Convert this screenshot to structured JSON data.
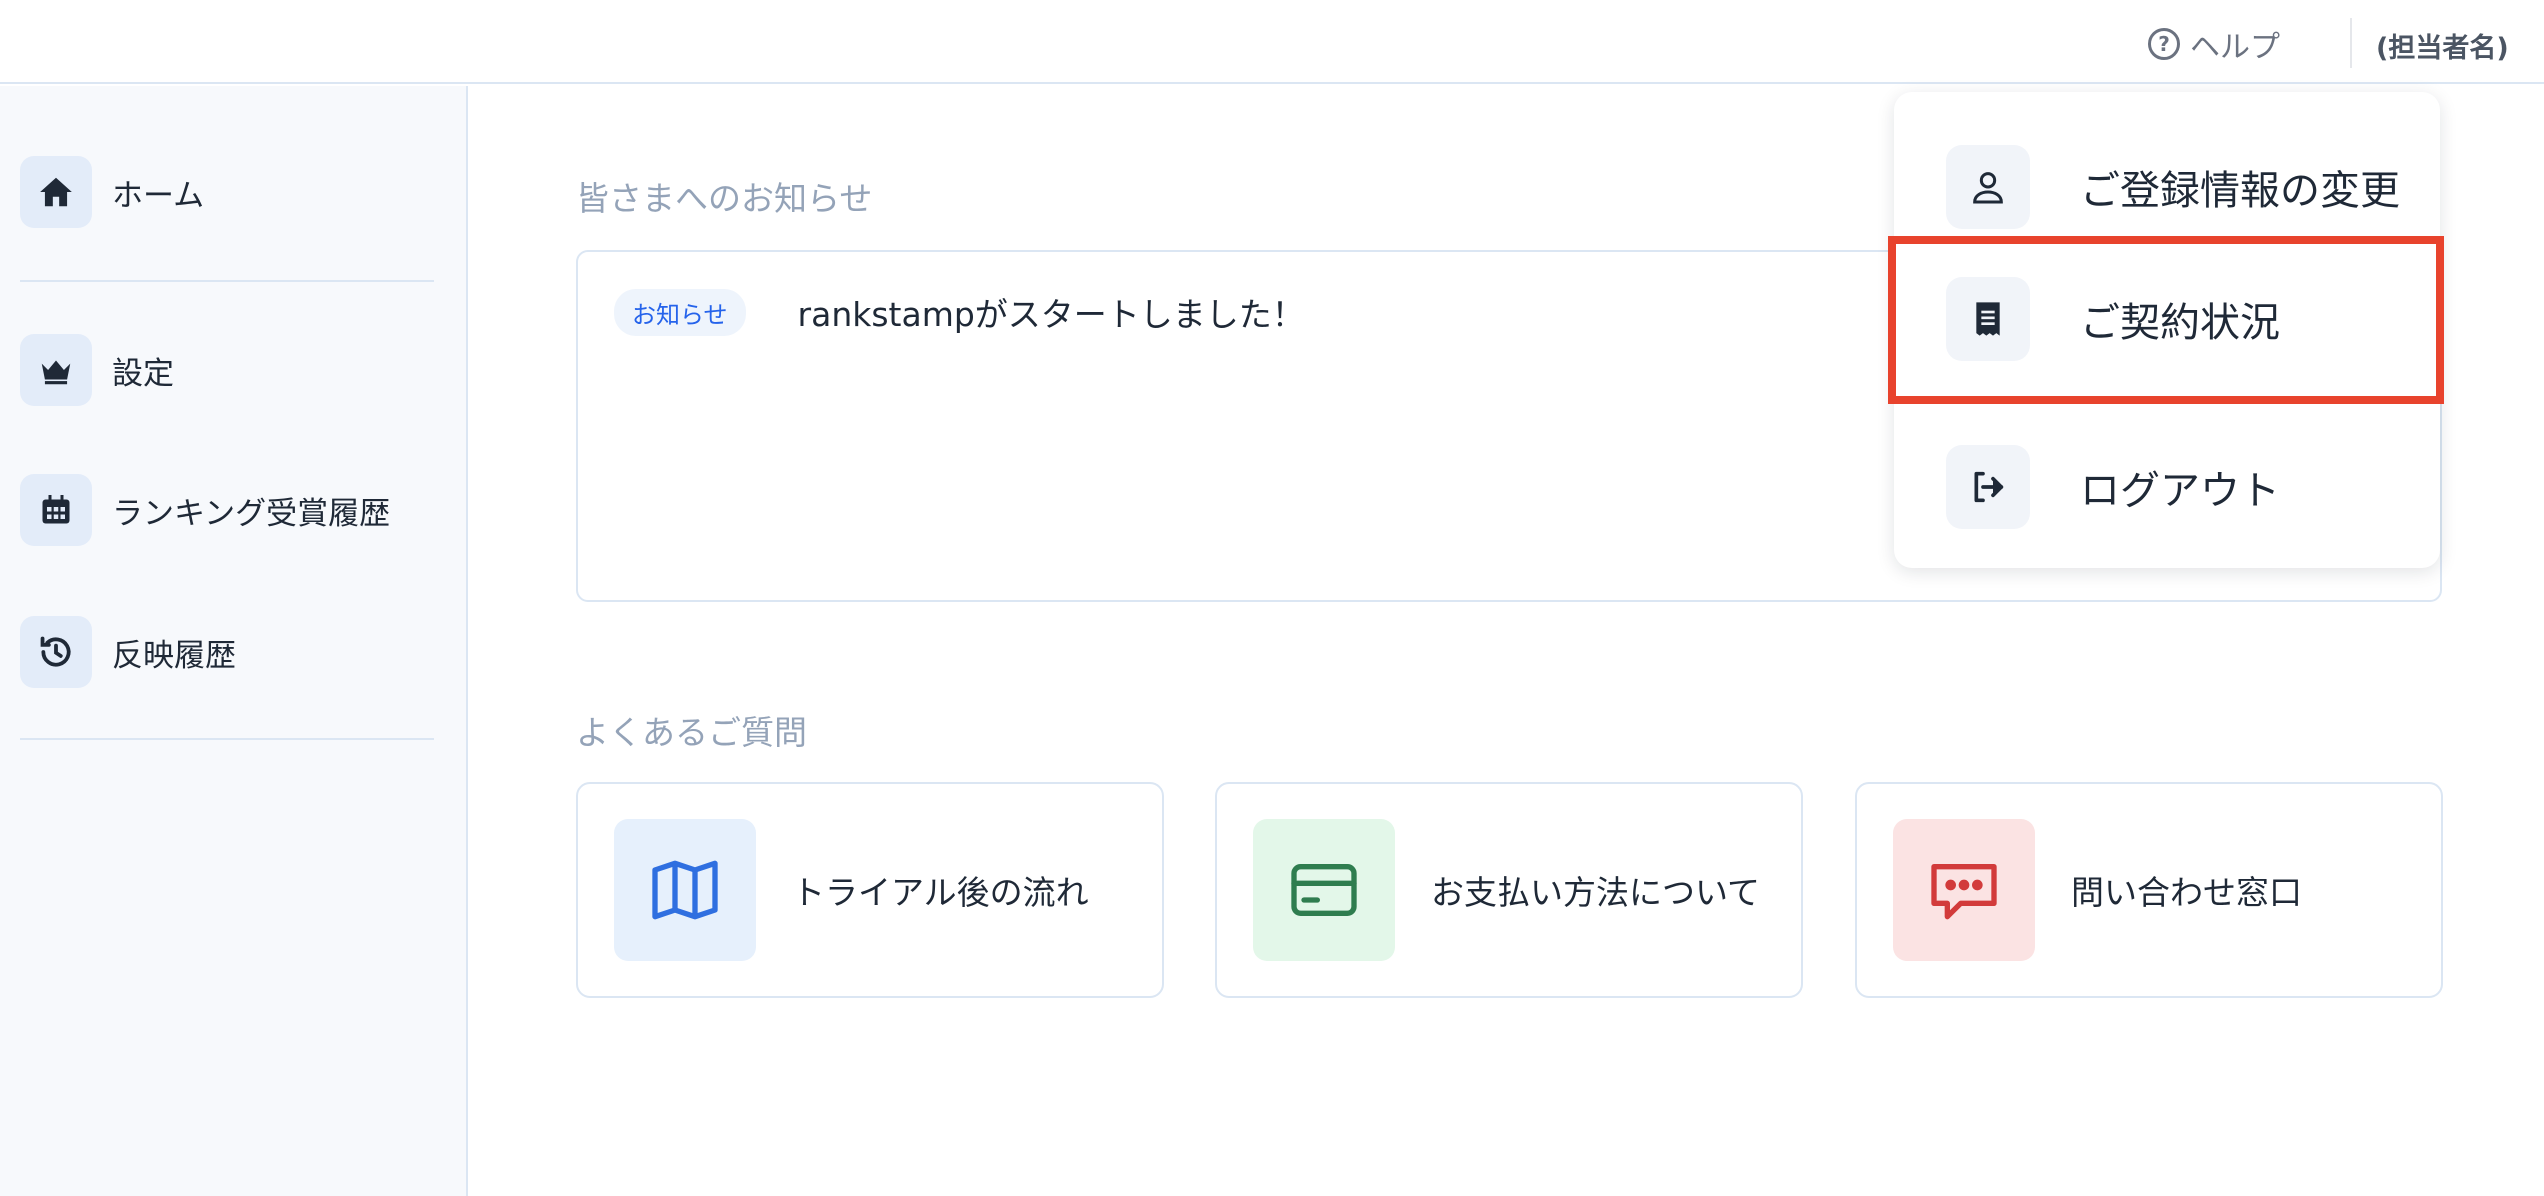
{
  "header": {
    "help_label": "ヘルプ",
    "help_icon": "question-circle-icon",
    "user_name": "(担当者名)"
  },
  "sidebar": {
    "items": [
      {
        "label": "ホーム",
        "icon": "home-icon"
      },
      {
        "label": "設定",
        "icon": "crown-icon"
      },
      {
        "label": "ランキング受賞履歴",
        "icon": "calendar-icon"
      },
      {
        "label": "反映履歴",
        "icon": "history-icon"
      }
    ]
  },
  "main": {
    "notices_title": "皆さまへのお知らせ",
    "notices": [
      {
        "badge": "お知らせ",
        "text": "rankstampがスタートしました！"
      }
    ],
    "faq_title": "よくあるご質問",
    "faq": [
      {
        "label": "トライアル後の流れ",
        "icon": "map-icon",
        "bg": "#e6f0fc",
        "color": "#2f6fe0"
      },
      {
        "label": "お支払い方法について",
        "icon": "credit-card-icon",
        "bg": "#e3f7e9",
        "color": "#2f7d4f"
      },
      {
        "label": "問い合わせ窓口",
        "icon": "chat-bubble-icon",
        "bg": "#fbe3e3",
        "color": "#d23b3b"
      }
    ]
  },
  "user_menu": {
    "items": [
      {
        "label": "ご登録情報の変更",
        "icon": "user-icon"
      },
      {
        "label": "ご契約状況",
        "icon": "receipt-icon",
        "highlighted": true
      },
      {
        "label": "ログアウト",
        "icon": "logout-icon"
      }
    ],
    "highlight_color": "#e8432d"
  }
}
